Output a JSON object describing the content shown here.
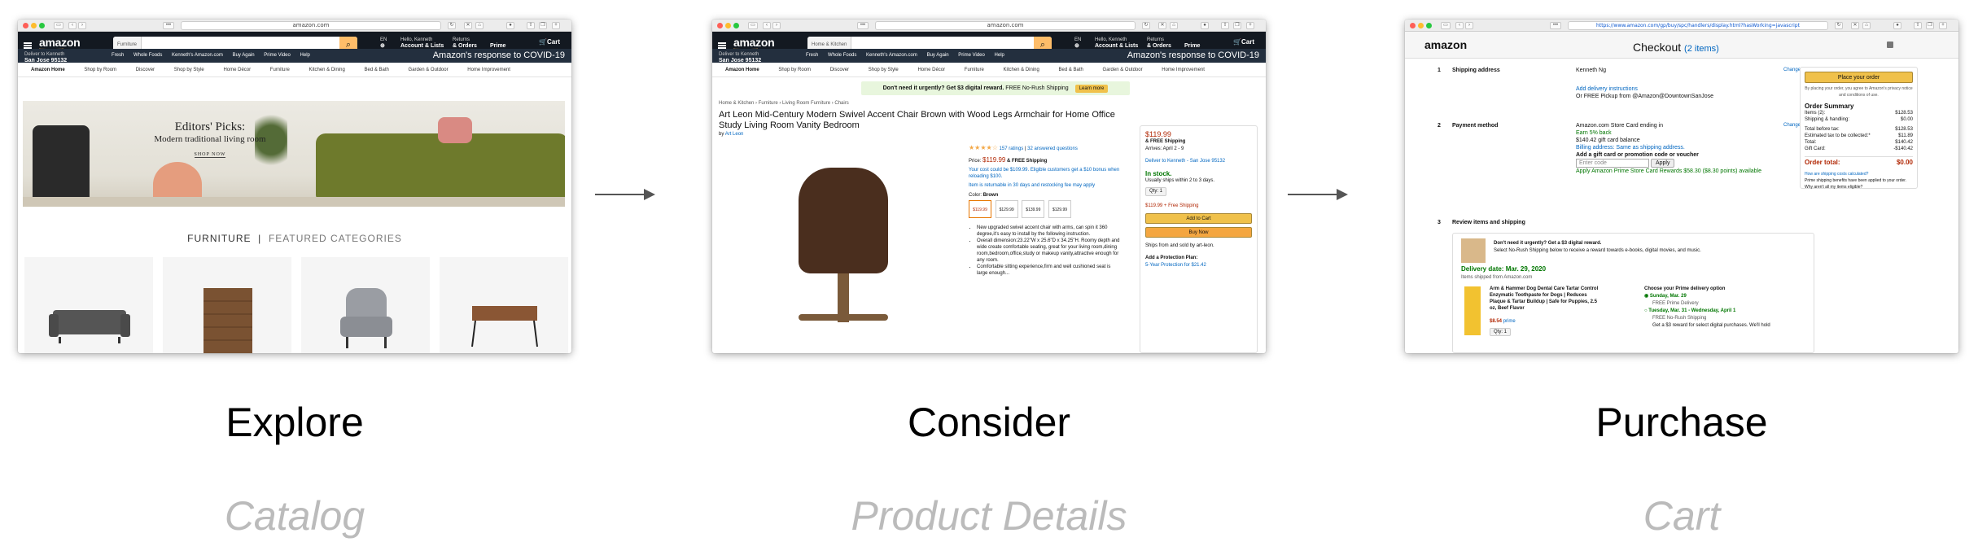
{
  "stages": [
    {
      "label": "Explore",
      "sublabel": "Catalog",
      "url": "amazon.com",
      "search_category": "Furniture",
      "banner": {
        "t1": "Editors' Picks:",
        "t2": "Modern traditional living room",
        "t3": "SHOP NOW"
      },
      "section_title": "FURNITURE",
      "section_subtitle": "FEATURED CATEGORIES"
    },
    {
      "label": "Consider",
      "sublabel": "Product Details",
      "url": "amazon.com",
      "search_category": "Home & Kitchen",
      "promo": "Don't need it urgently? Get $3 digital reward.",
      "promo_tail": "FREE No-Rush Shipping",
      "learn_more": "Learn more",
      "breadcrumb": "Home & Kitchen › Furniture › Living Room Furniture › Chairs",
      "title": "Art Leon Mid-Century Modern Swivel Accent Chair Brown with Wood Legs Armchair for Home Office Study Living Room Vanity Bedroom",
      "by": "by",
      "brand": "Art Leon",
      "ratings": "157 ratings",
      "answered": "32 answered questions",
      "price_label": "Price:",
      "price": "$119.99",
      "free_ship": "& FREE Shipping",
      "cost_note": "Your cost could be $109.99. Eligible customers get a $10 bonus when reloading $100.",
      "returnable": "Item is returnable in 30 days and restocking fee may apply",
      "color_label": "Color:",
      "color": "Brown",
      "swatch_prices": [
        "$119.99",
        "$129.99",
        "$139.99",
        "$129.99"
      ],
      "bullets": [
        "New upgraded swivel accent chair with arms, can spin it 360 degree,it's easy to install by the following instruction.",
        "Overall dimension:23.22\"W x 25.6\"D x 34.25\"H. Roomy depth and wide create comfortable seating, great for your living room,dining room,bedroom,office,study or makeup vanity,attractive enough for any room.",
        "Comfortable sitting experience,firm and well cushioned seat is large enough..."
      ],
      "buy_price": "$119.99",
      "buy_free": "& FREE Shipping",
      "arrives": "Arrives: April 2 - 9",
      "deliver_to": "Deliver to Kenneth - San Jose 95132",
      "stock": "In stock.",
      "ships": "Usually ships within 2 to 3 days.",
      "qty": "Qty: 1",
      "buy_price2": "$119.99 + Free Shipping",
      "add_to_cart": "Add to Cart",
      "buy_now": "Buy Now",
      "sold_by": "Ships from and sold by art-leon.",
      "protection": "Add a Protection Plan:",
      "protection_item": "5-Year Protection for $21.42"
    },
    {
      "label": "Purchase",
      "sublabel": "Cart",
      "url": "https://www.amazon.com/gp/buy/spc/handlers/display.html?hasWorking=javascript",
      "logo": "amazon",
      "checkout": "Checkout",
      "items": "(2 items)",
      "s1_num": "1",
      "s1_title": "Shipping address",
      "s1_body": "Kenneth Ng",
      "s1_link": "Add delivery instructions",
      "s1_pickup": "Or FREE Pickup from @Amazon@DowntownSanJose",
      "change": "Change",
      "s2_num": "2",
      "s2_title": "Payment method",
      "s2_body": "Amazon.com Store Card ending in",
      "s2_earn": "Earn 5% back",
      "s2_gift": "$140.42 gift card balance",
      "s2_billing": "Billing address: Same as shipping address.",
      "s2_addgift": "Add a gift card or promotion code or voucher",
      "s2_enter": "Enter code",
      "s2_apply": "Apply",
      "s2_rewards": "Apply Amazon Prime Store Card Rewards $58.30 ($8.30 points) available",
      "s3_num": "3",
      "s3_title": "Review items and shipping",
      "review_head": "Don't need it urgently? Get a $3 digital reward.",
      "review_sub": "Select No-Rush Shipping below to receive a reward towards e-books, digital movies, and music.",
      "delivery": "Delivery date: Mar. 29, 2020",
      "shipped_from": "Items shipped from Amazon.com",
      "item_name": "Arm & Hammer Dog Dental Care Tartar Control Enzymatic Toothpaste for Dogs | Reduces Plaque & Tartar Buildup | Safe for Puppies, 2.5 oz, Beef Flavor",
      "item_price": "$8.54",
      "prime": "prime",
      "item_qty": "Qty: 1",
      "opt_head": "Choose your Prime delivery option",
      "opt1": "Sunday, Mar. 29",
      "opt1b": "FREE Prime Delivery",
      "opt2": "Tuesday, Mar. 31 - Wednesday, April 1",
      "opt2b": "FREE No-Rush Shipping",
      "opt2c": "Get a $3 reward for select digital purchases. We'll hold",
      "place_order": "Place your order",
      "agree": "By placing your order, you agree to Amazon's privacy notice and conditions of use.",
      "summary_title": "Order Summary",
      "summary": [
        {
          "k": "Items (2):",
          "v": "$128.53"
        },
        {
          "k": "Shipping & handling:",
          "v": "$0.00"
        },
        {
          "k": "Total before tax:",
          "v": "$128.53"
        },
        {
          "k": "Estimated tax to be collected:*",
          "v": "$11.89"
        },
        {
          "k": "Total:",
          "v": "$140.42"
        },
        {
          "k": "Gift Card:",
          "v": "-$140.42"
        }
      ],
      "order_total_label": "Order total:",
      "order_total": "$0.00",
      "ship_calc": "How are shipping costs calculated?",
      "prime_note": "Prime shipping benefits have been applied to your order. Why aren't all my items eligible?"
    }
  ],
  "header": {
    "deliver_line1": "Deliver to Kenneth",
    "deliver_line2": "San Jose 95132",
    "lang": "EN",
    "hello": "Hello, Kenneth",
    "account": "Account & Lists",
    "returns": "Returns",
    "orders": "& Orders",
    "prime": "Prime",
    "cart": "Cart",
    "nav": [
      "Fresh",
      "Whole Foods",
      "Kenneth's Amazon.com",
      "Buy Again",
      "Prime Video",
      "Help"
    ],
    "covid": "Amazon's response to COVID-19",
    "catnav": [
      "Amazon Home",
      "Shop by Room",
      "Discover",
      "Shop by Style",
      "Home Décor",
      "Furniture",
      "Kitchen & Dining",
      "Bed & Bath",
      "Garden & Outdoor",
      "Home Improvement"
    ]
  }
}
